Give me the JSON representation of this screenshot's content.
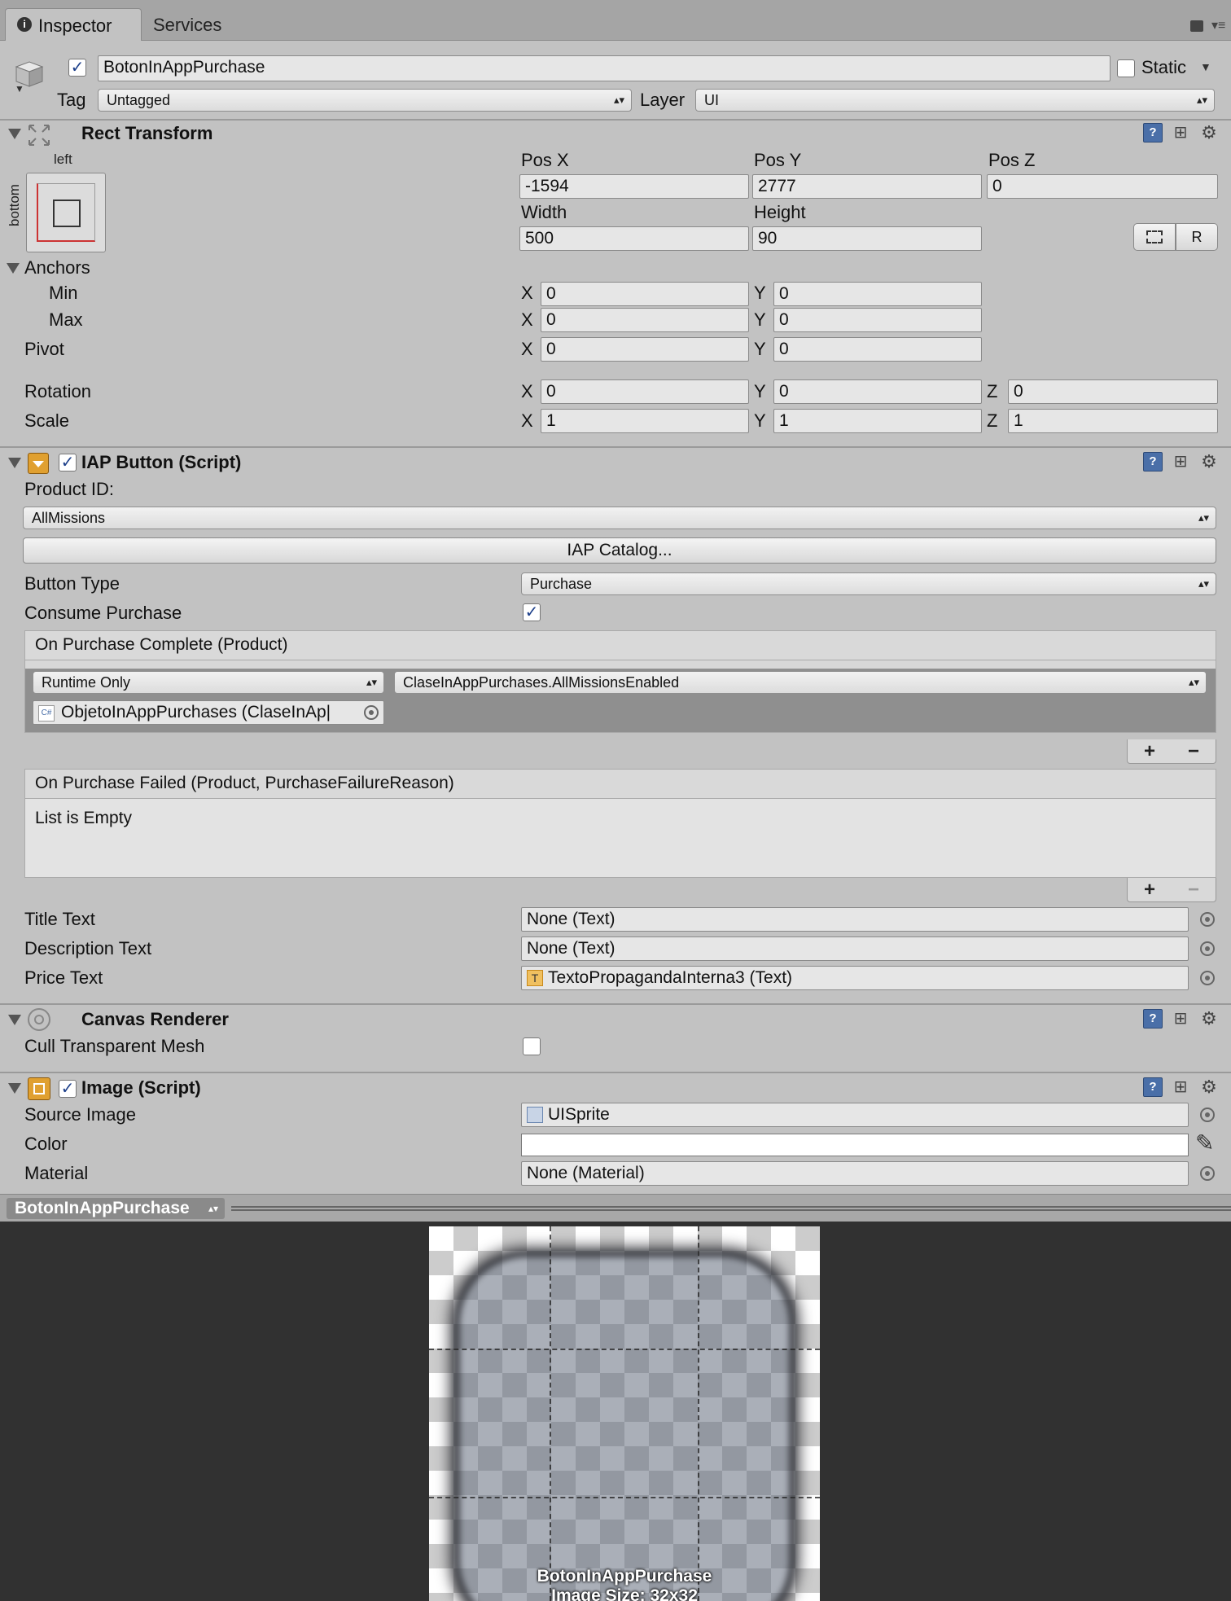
{
  "tabs": [
    {
      "label": "Inspector",
      "icon": "info-icon"
    },
    {
      "label": "Services"
    }
  ],
  "object": {
    "active": true,
    "name": "BotonInAppPurchase",
    "static_label": "Static",
    "static_checked": false,
    "tag_label": "Tag",
    "tag_value": "Untagged",
    "layer_label": "Layer",
    "layer_value": "UI"
  },
  "rect_transform": {
    "title": "Rect Transform",
    "anchor_preset_top": "left",
    "anchor_preset_side": "bottom",
    "pos_x_label": "Pos X",
    "pos_y_label": "Pos Y",
    "pos_z_label": "Pos Z",
    "pos_x": "-1594",
    "pos_y": "2777",
    "pos_z": "0",
    "width_label": "Width",
    "height_label": "Height",
    "width": "500",
    "height": "90",
    "raw_button": "R",
    "anchors_label": "Anchors",
    "min_label": "Min",
    "max_label": "Max",
    "pivot_label": "Pivot",
    "rotation_label": "Rotation",
    "scale_label": "Scale",
    "x": "X",
    "y": "Y",
    "z": "Z",
    "anchor_min_x": "0",
    "anchor_min_y": "0",
    "anchor_max_x": "0",
    "anchor_max_y": "0",
    "pivot_x": "0",
    "pivot_y": "0",
    "rotation_x": "0",
    "rotation_y": "0",
    "rotation_z": "0",
    "scale_x": "1",
    "scale_y": "1",
    "scale_z": "1"
  },
  "iap_button": {
    "title": "IAP Button (Script)",
    "enabled": true,
    "product_id_label": "Product ID:",
    "product_id_value": "AllMissions",
    "catalog_button": "IAP Catalog...",
    "button_type_label": "Button Type",
    "button_type_value": "Purchase",
    "consume_label": "Consume Purchase",
    "consume_checked": true,
    "on_complete_title": "On Purchase Complete (Product)",
    "runtime_value": "Runtime Only",
    "function_value": "ClaseInAppPurchases.AllMissionsEnabled",
    "target_object": "ObjetoInAppPurchases (ClaseInAp|",
    "on_failed_title": "On Purchase Failed (Product, PurchaseFailureReason)",
    "list_empty": "List is Empty",
    "plus": "+",
    "minus": "−",
    "title_text_label": "Title Text",
    "title_text_value": "None (Text)",
    "description_text_label": "Description Text",
    "description_text_value": "None (Text)",
    "price_text_label": "Price Text",
    "price_text_value": "TextoPropagandaInterna3 (Text)"
  },
  "canvas_renderer": {
    "title": "Canvas Renderer",
    "cull_label": "Cull Transparent Mesh",
    "cull_checked": false
  },
  "image": {
    "title": "Image (Script)",
    "enabled": true,
    "source_label": "Source Image",
    "source_value": "UISprite",
    "color_label": "Color",
    "color_value": "#ffffff",
    "material_label": "Material",
    "material_value": "None (Material)"
  },
  "preview": {
    "header": "BotonInAppPurchase",
    "caption_name": "BotonInAppPurchase",
    "caption_size": "Image Size: 32x32"
  }
}
